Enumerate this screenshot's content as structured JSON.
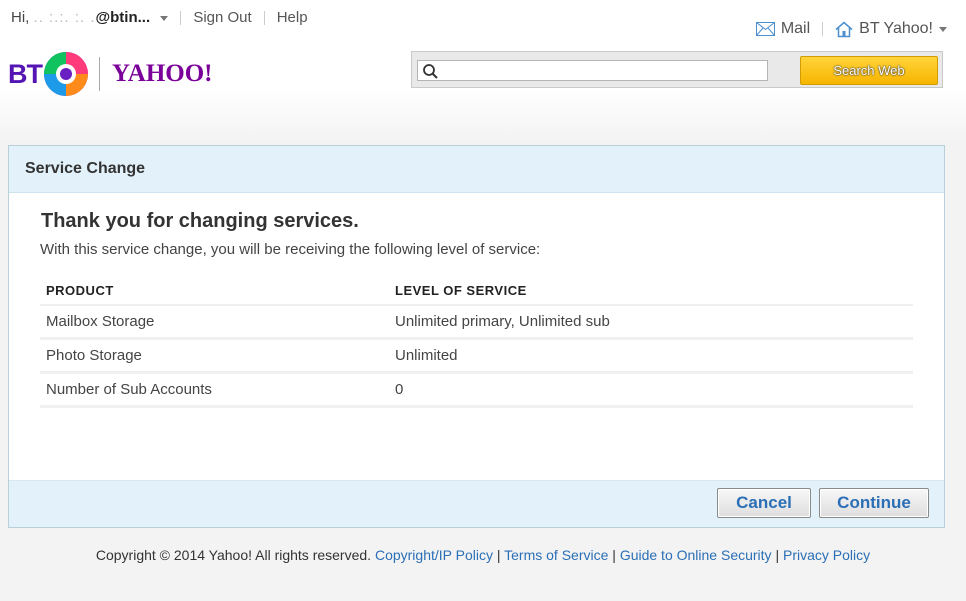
{
  "topnav": {
    "greeting": "Hi, ",
    "username": "@btin...",
    "sign_out": "Sign Out",
    "help": "Help",
    "mail": "Mail",
    "bt_yahoo": "BT Yahoo!"
  },
  "logo": {
    "bt": "BT",
    "yahoo": "YAHOO!"
  },
  "search": {
    "placeholder": "",
    "value": "",
    "button": "Search Web"
  },
  "panel": {
    "header": "Service Change",
    "title": "Thank you for changing services.",
    "description": "With this service change, you will be receiving the following level of service:",
    "columns": [
      "PRODUCT",
      "LEVEL OF SERVICE"
    ],
    "rows": [
      {
        "product": "Mailbox Storage",
        "level": "Unlimited primary, Unlimited sub"
      },
      {
        "product": "Photo Storage",
        "level": "Unlimited"
      },
      {
        "product": "Number of Sub Accounts",
        "level": "0"
      }
    ],
    "cancel": "Cancel",
    "continue": "Continue"
  },
  "footer": {
    "copyright": "Copyright © 2014 Yahoo! All rights reserved.",
    "links": [
      "Copyright/IP Policy",
      "Terms of Service",
      "Guide to Online Security",
      "Privacy Policy"
    ]
  },
  "colors": {
    "accent": "#2b6fb6",
    "panel_header_bg": "#e2f1fa",
    "search_button": "#f7b500",
    "bt_purple": "#5514b4",
    "yahoo_purple": "#7b0099"
  },
  "icons": [
    "chevron-down-icon",
    "mail-icon",
    "home-icon",
    "search-icon",
    "bt-globe-icon"
  ]
}
